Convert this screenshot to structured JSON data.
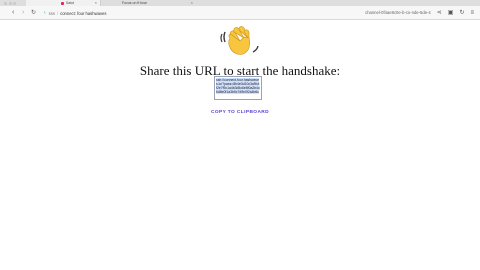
{
  "browser": {
    "tabs": [
      {
        "label": "Salut"
      },
      {
        "label": "Focus on ft fuse"
      }
    ],
    "url": {
      "scheme_host": "sss",
      "path": "connect: four hashwaves"
    },
    "toolbar_right_text": "channel-0f4ae8c0e-b-co-nde-5de-4"
  },
  "page": {
    "emoji": "waving-hand",
    "heading": "Share this URL to start the handshake:",
    "url_text": "ssh://connect-four.hashwaves.io/?pass=8b4e0d10c3a9b4f2e7f9c1a4b3d5c6e8f0a2b4c6d8e0f1a3b5c7d9e0f2a4b6c",
    "copy_label": "COPY TO CLIPBOARD"
  }
}
